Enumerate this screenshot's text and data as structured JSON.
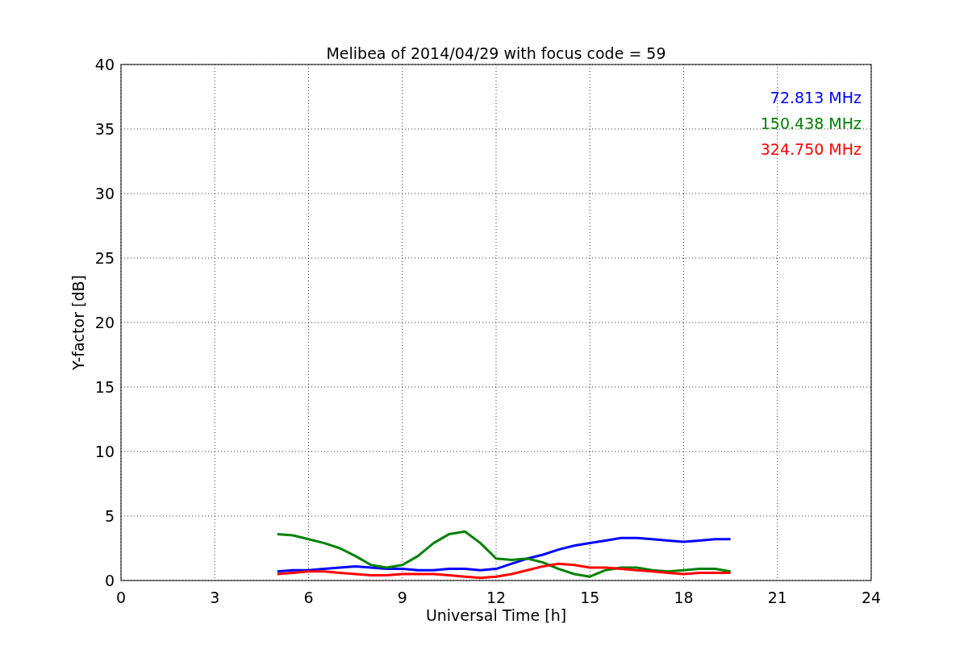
{
  "chart_data": {
    "type": "line",
    "title": "Melibea of 2014/04/29 with focus code = 59",
    "xlabel": "Universal Time [h]",
    "ylabel": "Y-factor [dB]",
    "x": [
      5,
      5.5,
      6,
      6.5,
      7,
      7.5,
      8,
      8.5,
      9,
      9.5,
      10,
      10.5,
      11,
      11.5,
      12,
      12.5,
      13,
      13.5,
      14,
      14.5,
      15,
      15.5,
      16,
      16.5,
      17,
      17.5,
      18,
      18.5,
      19,
      19.5
    ],
    "series": [
      {
        "name": "72.813 MHz",
        "color": "#0000ff",
        "values": [
          0.7,
          0.8,
          0.8,
          0.9,
          1.0,
          1.1,
          1.0,
          0.9,
          0.9,
          0.8,
          0.8,
          0.9,
          0.9,
          0.8,
          0.9,
          1.3,
          1.7,
          2.0,
          2.4,
          2.7,
          2.9,
          3.1,
          3.3,
          3.3,
          3.2,
          3.1,
          3.0,
          3.1,
          3.2,
          3.2
        ]
      },
      {
        "name": "150.438 MHz",
        "color": "#008000",
        "values": [
          3.6,
          3.5,
          3.2,
          2.9,
          2.5,
          1.9,
          1.2,
          1.0,
          1.2,
          1.9,
          2.9,
          3.6,
          3.8,
          2.9,
          1.7,
          1.6,
          1.7,
          1.4,
          0.9,
          0.5,
          0.3,
          0.8,
          1.0,
          1.0,
          0.8,
          0.7,
          0.8,
          0.9,
          0.9,
          0.7
        ]
      },
      {
        "name": "324.750 MHz",
        "color": "#ff0000",
        "values": [
          0.5,
          0.6,
          0.7,
          0.7,
          0.6,
          0.5,
          0.4,
          0.4,
          0.5,
          0.5,
          0.5,
          0.4,
          0.3,
          0.2,
          0.3,
          0.5,
          0.8,
          1.1,
          1.3,
          1.2,
          1.0,
          1.0,
          0.9,
          0.8,
          0.7,
          0.6,
          0.5,
          0.6,
          0.6,
          0.6
        ]
      }
    ],
    "grid": true,
    "xlim": [
      0,
      24
    ],
    "ylim": [
      0,
      40
    ],
    "xticks": [
      0,
      3,
      6,
      9,
      12,
      15,
      18,
      21,
      24
    ],
    "yticks": [
      0,
      5,
      10,
      15,
      20,
      25,
      30,
      35,
      40
    ]
  }
}
